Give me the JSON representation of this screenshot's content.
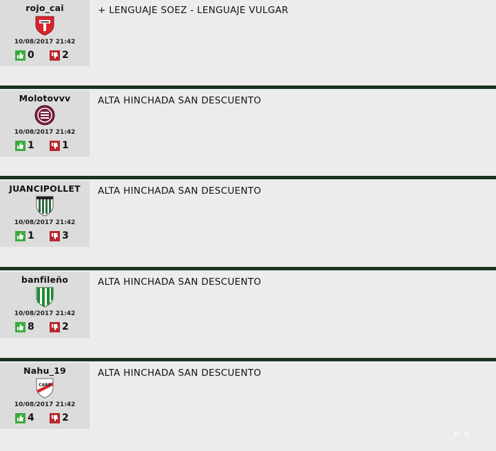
{
  "comments": [
    {
      "username": "rojo_cai",
      "badge": "independiente-crest-icon",
      "date": "10/08/2017 21:42",
      "likes": "0",
      "dislikes": "2",
      "text": "+ LENGUAJE SOEZ - LENGUAJE VULGAR"
    },
    {
      "username": "Molotovvv",
      "badge": "lanus-crest-icon",
      "date": "10/08/2017 21:42",
      "likes": "1",
      "dislikes": "1",
      "text": "ALTA HINCHADA SAN DESCUENTO"
    },
    {
      "username": "JUANCIPOLLET",
      "badge": "cipolletti-crest-icon",
      "date": "10/08/2017 21:42",
      "likes": "1",
      "dislikes": "3",
      "text": "ALTA HINCHADA SAN DESCUENTO"
    },
    {
      "username": "banfileño",
      "badge": "banfield-crest-icon",
      "date": "10/08/2017 21:42",
      "likes": "8",
      "dislikes": "2",
      "text": "ALTA HINCHADA SAN DESCUENTO"
    },
    {
      "username": "Nahu_19",
      "badge": "river-plate-crest-icon",
      "date": "10/08/2017 21:42",
      "likes": "4",
      "dislikes": "2",
      "text": "ALTA HINCHADA SAN DESCUENTO"
    }
  ],
  "colors": {
    "separator": "#1c3322",
    "like": "#3daa3d",
    "dislike": "#b8282e"
  }
}
